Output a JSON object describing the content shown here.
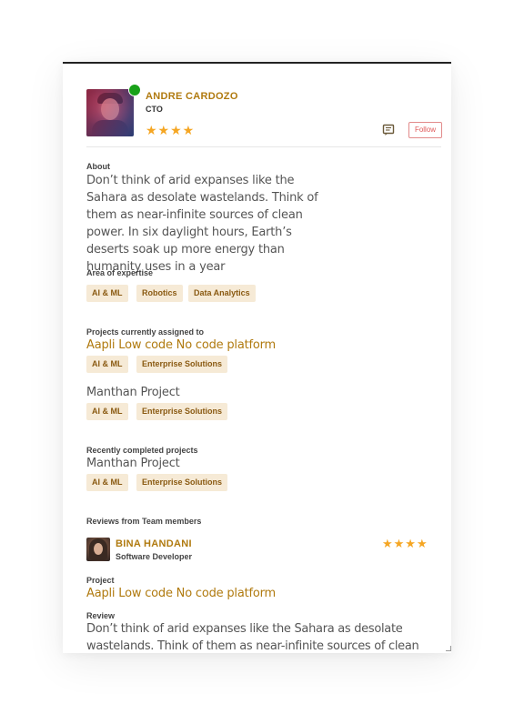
{
  "profile": {
    "name": "ANDRE CARDOZO",
    "role": "CTO",
    "rating": "★★★★",
    "status_color": "#19a119",
    "follow_label": "Follow",
    "message_icon": "message-icon"
  },
  "about": {
    "label": "About",
    "text": "Don’t think of arid expanses like the Sahara as desolate wastelands. Think of them as near-infinite sources of clean power. In six daylight hours, Earth’s deserts soak up more energy than humanity uses in a year"
  },
  "expertise": {
    "label": "Area of expertise",
    "tags": [
      "AI & ML",
      "Robotics",
      "Data Analytics"
    ]
  },
  "current_projects": {
    "label": "Projects currently assigned to",
    "items": [
      {
        "name": "Aapli Low code No code platform",
        "tags": [
          "AI & ML",
          "Enterprise Solutions"
        ]
      },
      {
        "name": "Manthan  Project",
        "tags": [
          "AI & ML",
          "Enterprise Solutions"
        ]
      }
    ]
  },
  "completed_projects": {
    "label": "Recently completed projects",
    "items": [
      {
        "name": "Manthan  Project",
        "tags": [
          "AI & ML",
          "Enterprise Solutions"
        ]
      }
    ]
  },
  "reviews": {
    "label": "Reviews from Team members",
    "items": [
      {
        "name": "BINA HANDANI",
        "role": "Software Developer",
        "rating": "★★★★",
        "project_label": "Project",
        "project": "Aapli Low code No code platform",
        "review_label": "Review",
        "review": "Don’t think of arid expanses like the Sahara as desolate wastelands. Think of them as near-infinite sources of clean power."
      }
    ]
  },
  "colors": {
    "accent": "#b07a0f",
    "tag_bg": "#f6ead6",
    "tag_text": "#8a5a12",
    "star": "#f5a623",
    "follow_border": "#e28a8a"
  }
}
